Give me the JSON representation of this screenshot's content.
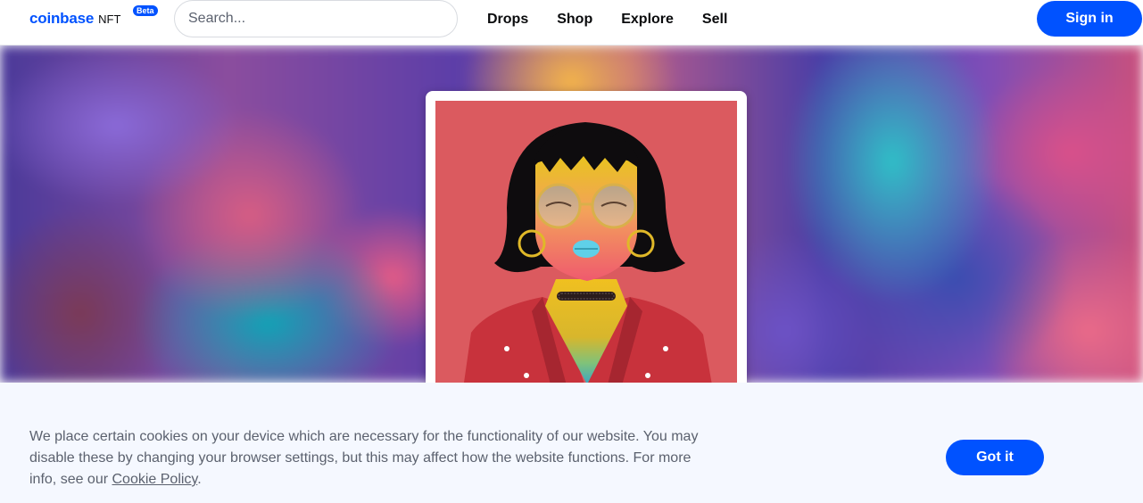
{
  "header": {
    "logo_word": "coinbase",
    "logo_suffix": "NFT",
    "beta_badge": "Beta",
    "search_placeholder": "Search...",
    "nav": [
      "Drops",
      "Shop",
      "Explore",
      "Sell"
    ],
    "signin_label": "Sign in"
  },
  "hero": {
    "featured_art_icon": "nft-portrait-artwork"
  },
  "cookie_banner": {
    "text_main": "We place certain cookies on your device which are necessary for the functionality of our website. You may disable these by changing your browser settings, but this may affect how the website functions. For more info, see our ",
    "link_text": "Cookie Policy",
    "text_end": ".",
    "button_label": "Got it"
  },
  "colors": {
    "brand_blue": "#0052ff",
    "banner_bg": "#f5f8ff",
    "text_muted": "#5b616e"
  }
}
